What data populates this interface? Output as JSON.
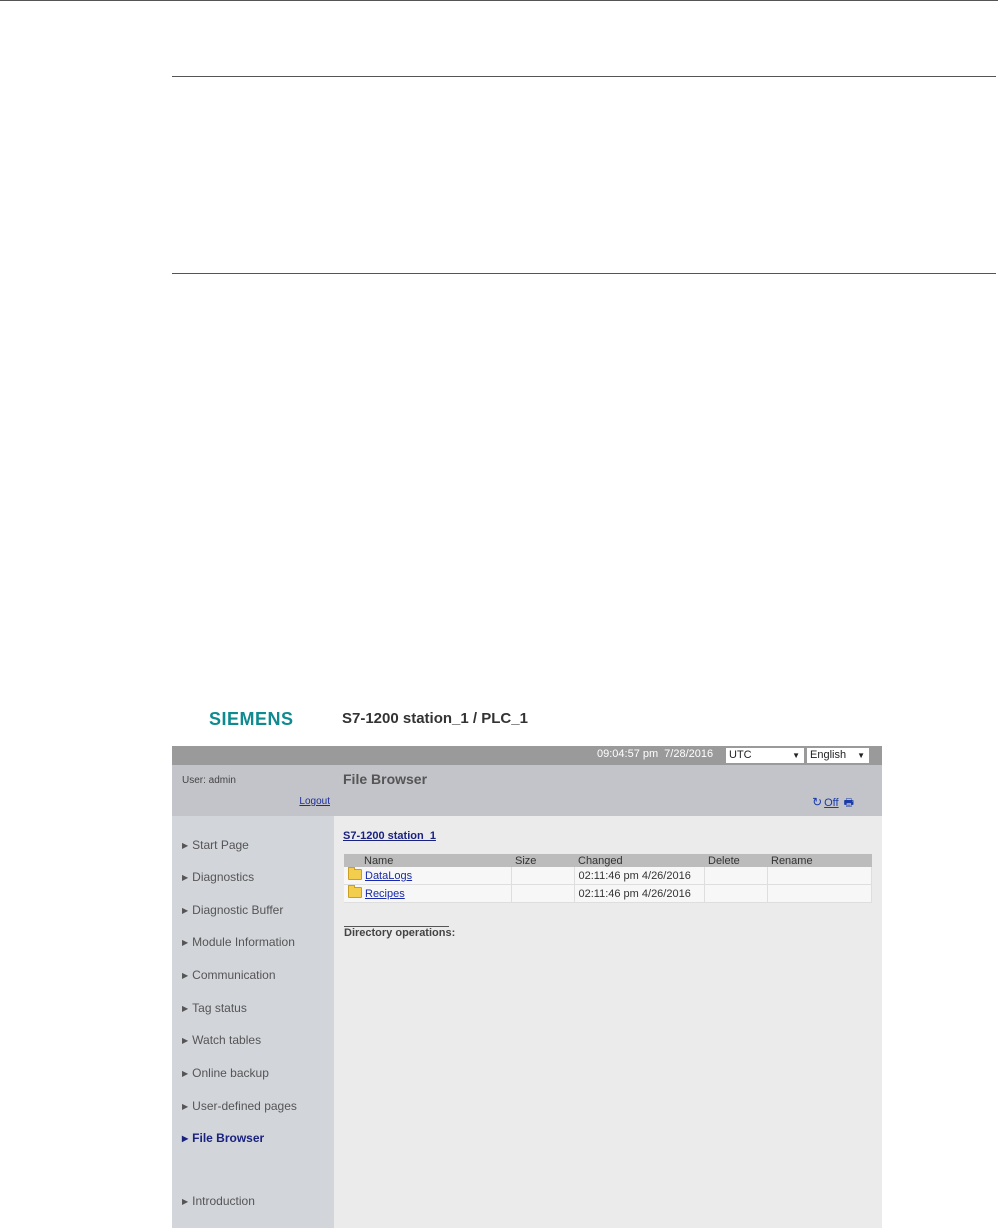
{
  "header": {
    "brand": "SIEMENS",
    "station": "S7-1200 station_1 / PLC_1"
  },
  "topbar": {
    "time": "09:04:57 pm",
    "date": "7/28/2016",
    "timezone": "UTC",
    "language": "English"
  },
  "sidebar": {
    "user": "User: admin",
    "logout": "Logout",
    "items": [
      {
        "label": "Start Page"
      },
      {
        "label": "Diagnostics"
      },
      {
        "label": "Diagnostic Buffer"
      },
      {
        "label": "Module Information"
      },
      {
        "label": "Communication"
      },
      {
        "label": "Tag status"
      },
      {
        "label": "Watch tables"
      },
      {
        "label": "Online backup"
      },
      {
        "label": "User-defined pages"
      },
      {
        "label": "File Browser"
      },
      {
        "label": "Introduction"
      }
    ],
    "active": "File Browser"
  },
  "main": {
    "title": "File Browser",
    "refresh_label": "Off",
    "breadcrumb": "S7-1200 station_1",
    "table": {
      "headers": [
        "Name",
        "Size",
        "Changed",
        "Delete",
        "Rename"
      ],
      "rows": [
        {
          "name": "DataLogs",
          "size": "",
          "changed": "02:11:46 pm  4/26/2016",
          "delete": "",
          "rename": ""
        },
        {
          "name": "Recipes",
          "size": "",
          "changed": "02:11:46 pm  4/26/2016",
          "delete": "",
          "rename": ""
        }
      ]
    },
    "dir_ops": "Directory operations:"
  },
  "icons": {
    "refresh": "refresh-icon",
    "print": "print-icon",
    "folder": "folder-icon",
    "dropdown": "chevron-down-icon"
  },
  "colors": {
    "brand": "#0f8a8f",
    "active_nav": "#1a2280",
    "link": "#1a2aa8"
  }
}
